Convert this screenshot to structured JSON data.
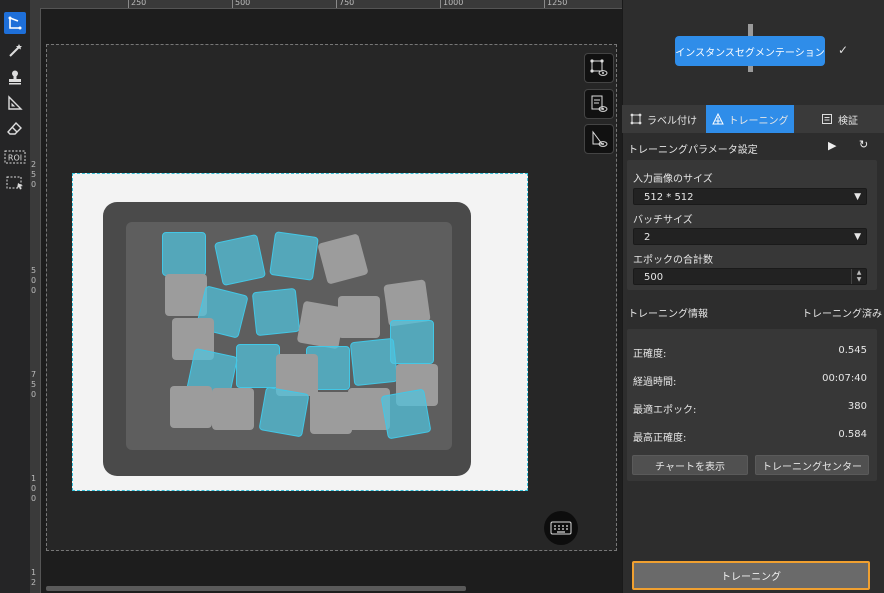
{
  "toolbar": {
    "tools": [
      {
        "icon": "polygon-tool-icon",
        "active": true
      },
      {
        "icon": "magic-wand-icon",
        "active": false
      },
      {
        "icon": "stamp-icon",
        "active": false
      },
      {
        "icon": "ruler-triangle-icon",
        "active": false
      },
      {
        "icon": "eraser-icon",
        "active": false
      },
      {
        "icon": "roi-icon",
        "label": "ROI",
        "active": false
      },
      {
        "icon": "image-select-icon",
        "active": false
      }
    ]
  },
  "ruler": {
    "top_labels": [
      "250",
      "500",
      "750",
      "1000",
      "1250"
    ],
    "left_labels": [
      "2",
      "5",
      "0",
      "5",
      "0",
      "0",
      "7",
      "5",
      "0",
      "1",
      "0",
      "0",
      "1",
      "2"
    ]
  },
  "canvas": {
    "view_buttons": [
      "polygon-visibility-icon",
      "label-visibility-icon",
      "mask-visibility-icon"
    ],
    "keyboard_icon": "keyboard-icon"
  },
  "mode": {
    "label": "インスタンスセグメンテーション",
    "check": "✓"
  },
  "tabs": [
    {
      "label": "ラベル付け",
      "icon": "label-icon"
    },
    {
      "label": "トレーニング",
      "icon": "training-icon",
      "active": true
    },
    {
      "label": "検証",
      "icon": "verify-icon"
    }
  ],
  "params": {
    "header": "トレーニングパラメータ設定",
    "play_icon": "▶",
    "reset_icon": "↻",
    "input_size_label": "入力画像のサイズ",
    "input_size_value": "512 * 512",
    "batch_label": "バッチサイズ",
    "batch_value": "2",
    "epoch_label": "エポックの合計数",
    "epoch_value": "500"
  },
  "info": {
    "header": "トレーニング情報",
    "status": "トレーニング済み",
    "stats": [
      {
        "label": "正確度:",
        "value": "0.545"
      },
      {
        "label": "経過時間:",
        "value": "00:07:40"
      },
      {
        "label": "最適エポック:",
        "value": "380"
      },
      {
        "label": "最高正確度:",
        "value": "0.584"
      }
    ],
    "chart_button": "チャートを表示",
    "center_button": "トレーニングセンター"
  },
  "train_button": "トレーニング"
}
